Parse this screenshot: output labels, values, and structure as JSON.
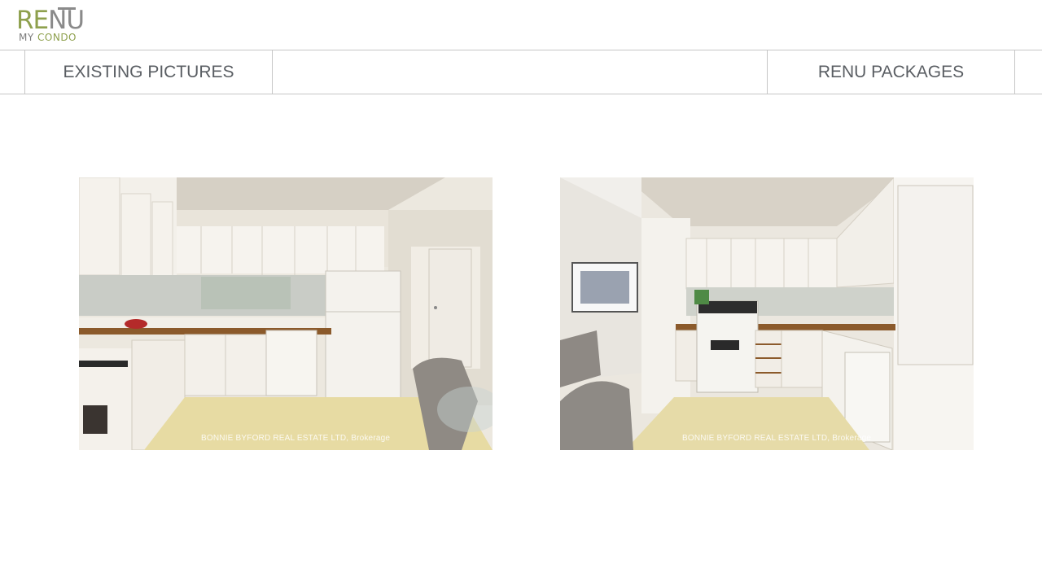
{
  "brand": {
    "logo_part1": "RE",
    "logo_part2": "NU",
    "logo_sub_part1": "MY",
    "logo_sub_part2": "CONDO",
    "accent_color": "#8ea04d",
    "secondary_color": "#8a8a8a"
  },
  "tabs": [
    {
      "label": "EXISTING PICTURES"
    },
    {
      "label": "RENU PACKAGES"
    }
  ],
  "photos": [
    {
      "icon": "kitchen-photo",
      "watermark": "BONNIE BYFORD REAL ESTATE LTD, Brokerage"
    },
    {
      "icon": "kitchen-photo",
      "watermark": "BONNIE BYFORD REAL ESTATE LTD, Brokerage"
    }
  ]
}
